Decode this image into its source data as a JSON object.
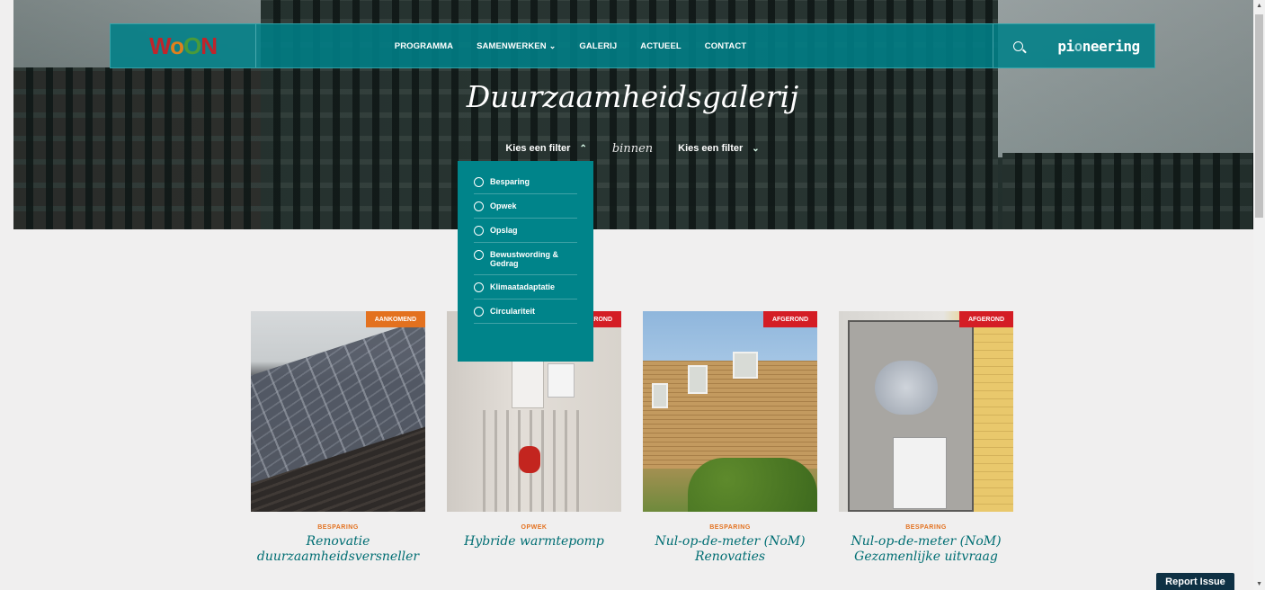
{
  "logo": {
    "text": "WOON",
    "alt": "logo"
  },
  "nav": {
    "items": [
      {
        "label": "PROGRAMMA"
      },
      {
        "label": "SAMENWERKEN"
      },
      {
        "label": "GALERIJ"
      },
      {
        "label": "ACTUEEL"
      },
      {
        "label": "CONTACT"
      }
    ],
    "partner": "pioneering"
  },
  "hero": {
    "title": "Duurzaamheidsgalerij",
    "filter1": "Kies een filter",
    "connector": "binnen",
    "filter2": "Kies een filter"
  },
  "dropdown": {
    "options": [
      {
        "label": "Besparing"
      },
      {
        "label": "Opwek"
      },
      {
        "label": "Opslag"
      },
      {
        "label": "Bewustwording & Gedrag"
      },
      {
        "label": "Klimaatadaptatie"
      },
      {
        "label": "Circulariteit"
      }
    ]
  },
  "cards": [
    {
      "badge": "AANKOMEND",
      "badge_color": "#e3711f",
      "category": "BESPARING",
      "title": "Renovatie duurzaamheidsversneller"
    },
    {
      "badge": "AFGEROND",
      "badge_color": "#d41d25",
      "category": "OPWEK",
      "title": "Hybride warmtepomp"
    },
    {
      "badge": "AFGEROND",
      "badge_color": "#d41d25",
      "category": "BESPARING",
      "title": "Nul-op-de-meter (NoM) Renovaties"
    },
    {
      "badge": "AFGEROND",
      "badge_color": "#d41d25",
      "category": "BESPARING",
      "title": "Nul-op-de-meter (NoM) Gezamenlijke uitvraag"
    }
  ],
  "report_button": "Report Issue",
  "colors": {
    "teal": "#00848a",
    "orange": "#e3711f",
    "red": "#d41d25",
    "title_teal": "#006e73"
  }
}
